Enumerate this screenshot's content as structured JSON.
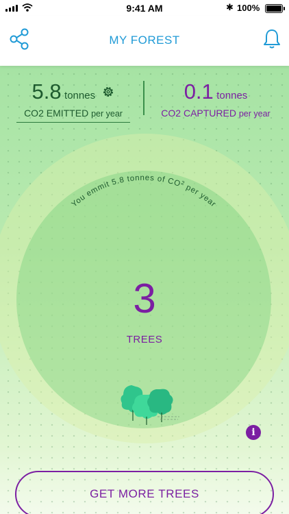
{
  "status_bar": {
    "time": "9:41 AM",
    "battery": "100%"
  },
  "header": {
    "title": "MY FOREST"
  },
  "emitted": {
    "value": "5.8",
    "unit": "tonnes",
    "label": "CO2 EMITTED",
    "label_suffix": "per year"
  },
  "captured": {
    "value": "0.1",
    "unit": "tonnes",
    "label": "CO2 CAPTURED",
    "label_suffix": "per year"
  },
  "arc_message": {
    "text": "You emmit 5.8 tonnes of CO",
    "superscript": "2",
    "suffix": " per year"
  },
  "trees": {
    "count": "3",
    "label": "TREES"
  },
  "info": {
    "symbol": "i"
  },
  "cta": {
    "label": "GET MORE TREES"
  },
  "colors": {
    "accent": "#1f9ad6",
    "green_dark": "#1d5a2e",
    "purple": "#7b1fa2",
    "tree_green": "#2fc58c"
  },
  "icons": {
    "share": "share-icon",
    "bell": "bell-icon",
    "gear": "gear-icon",
    "info": "info-icon"
  }
}
